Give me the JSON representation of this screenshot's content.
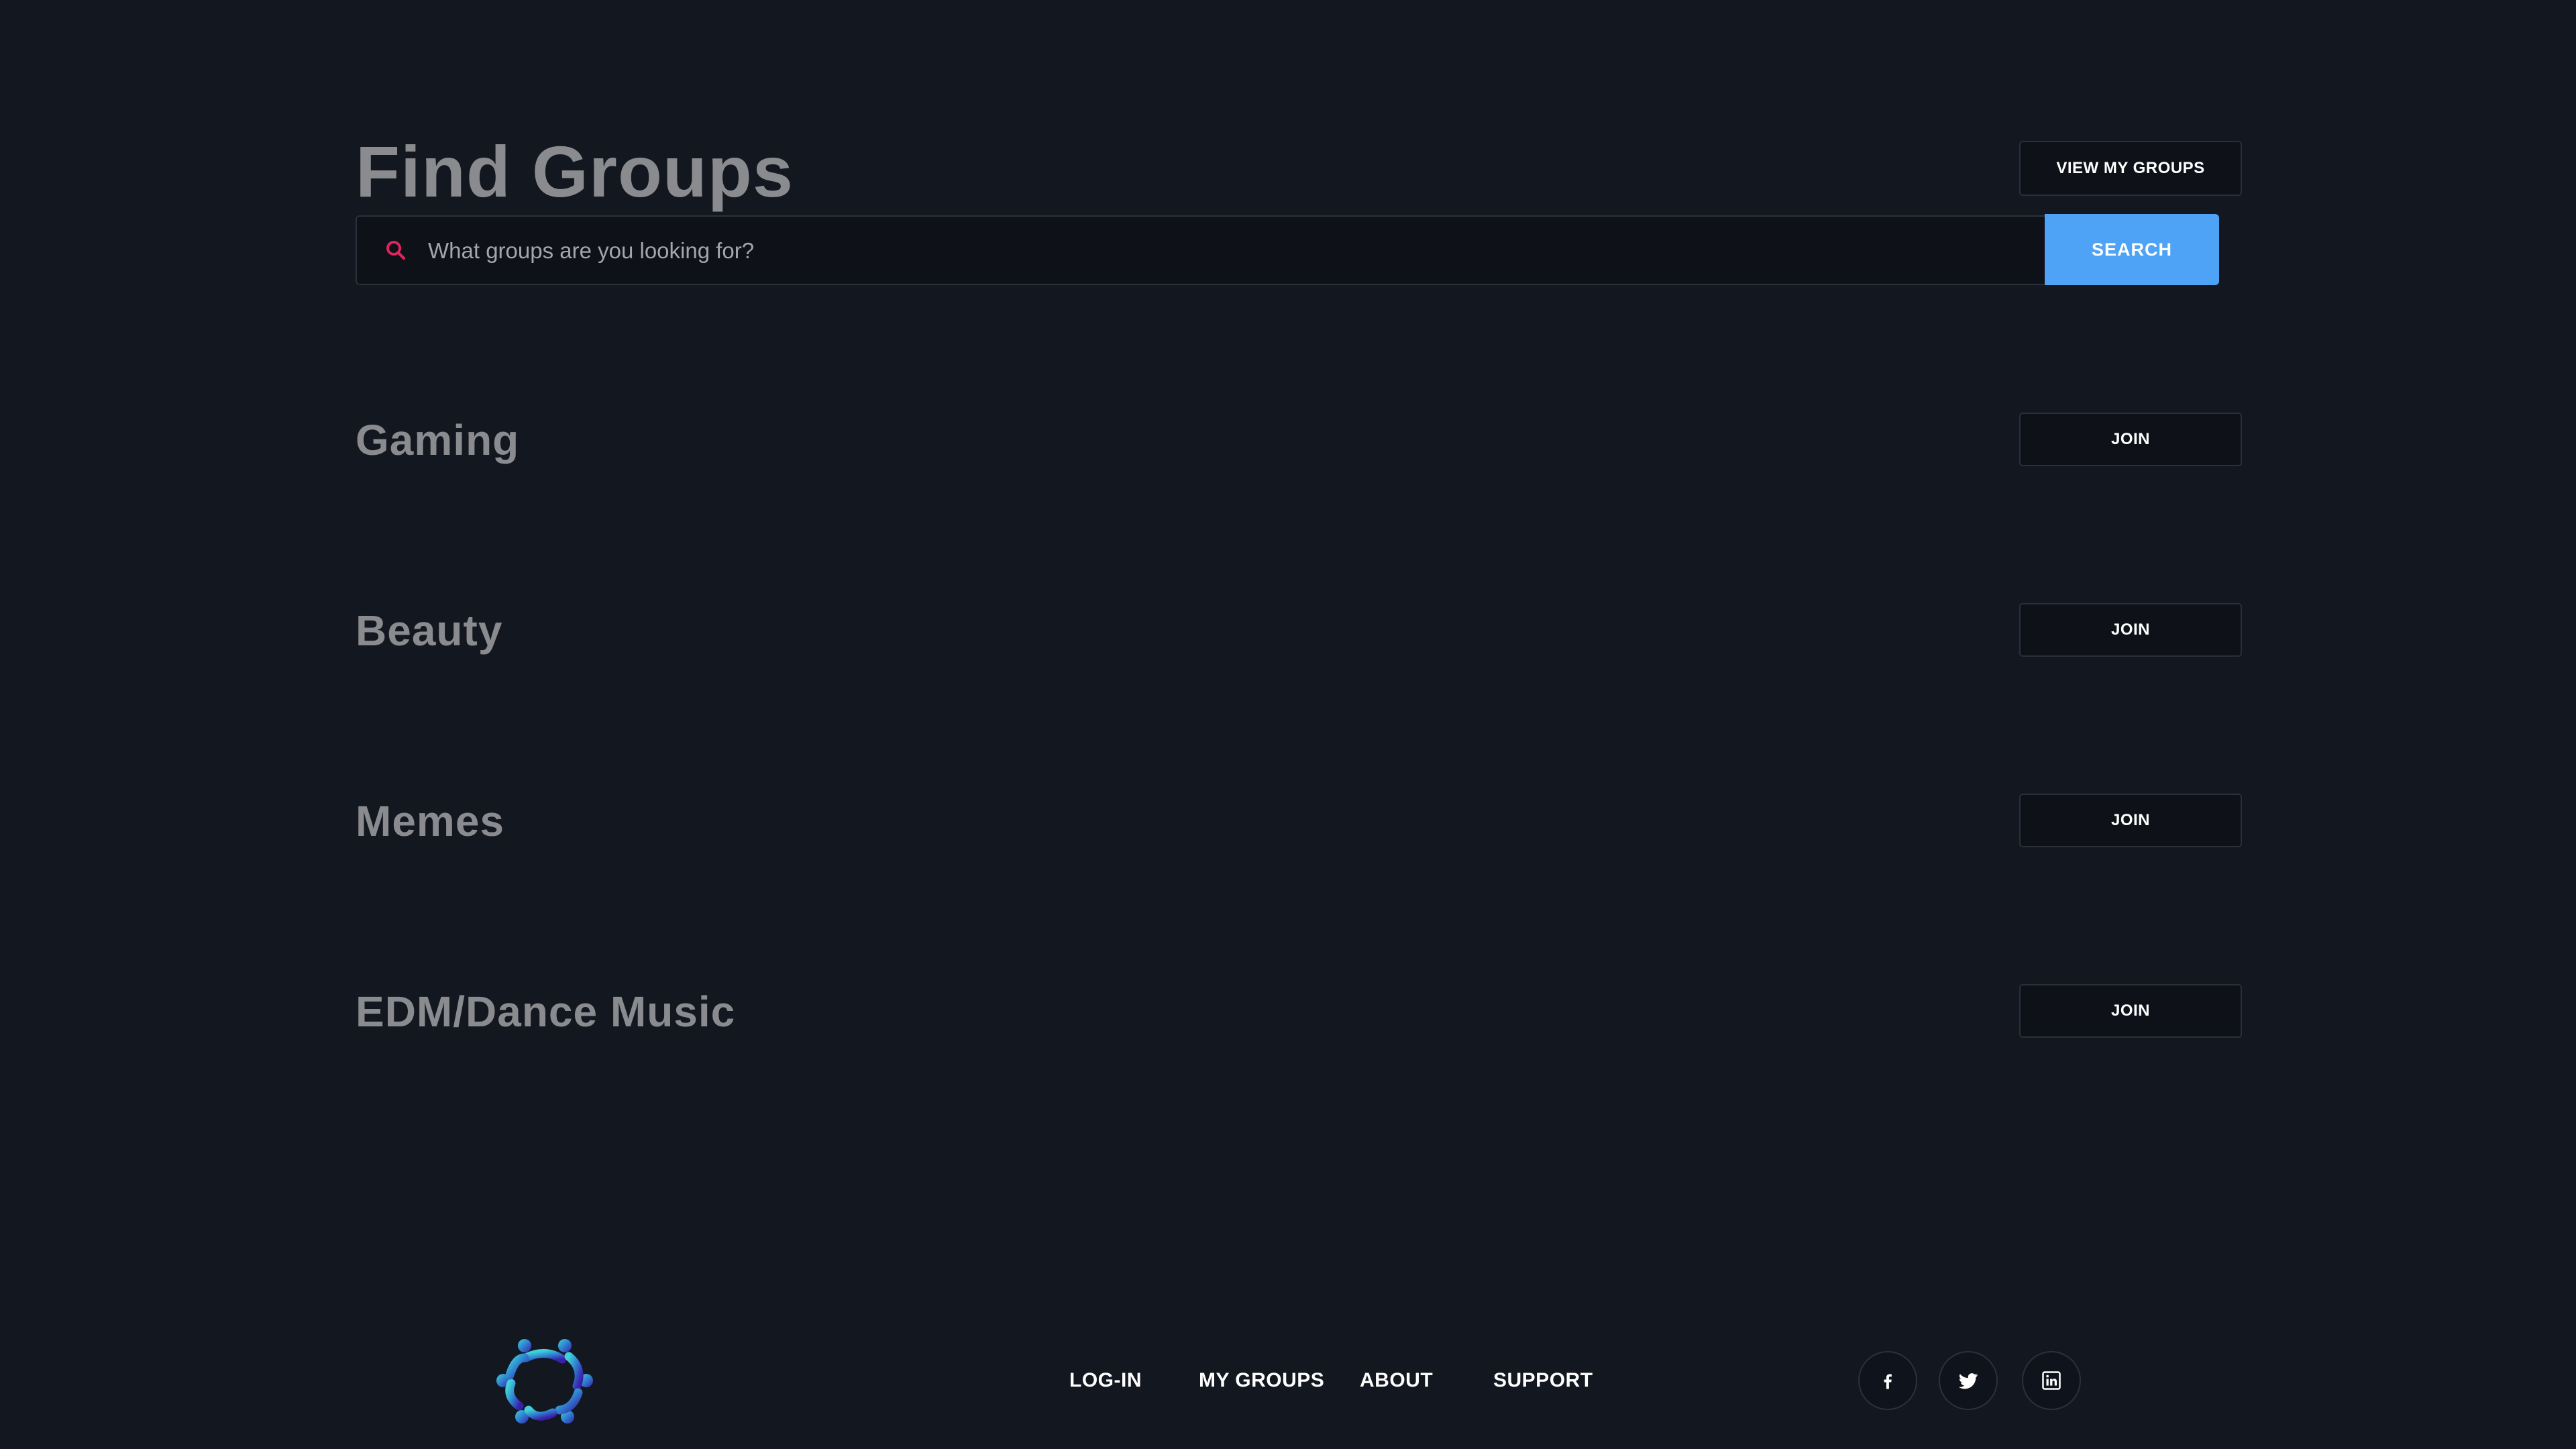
{
  "header": {
    "title": "Find Groups",
    "view_my_groups_label": "VIEW MY GROUPS"
  },
  "search": {
    "placeholder": "What groups are you looking for?",
    "button_label": "SEARCH",
    "icon": "search-icon",
    "icon_color": "#e0245e"
  },
  "groups": [
    {
      "name": "Gaming",
      "join_label": "JOIN"
    },
    {
      "name": "Beauty",
      "join_label": "JOIN"
    },
    {
      "name": "Memes",
      "join_label": "JOIN"
    },
    {
      "name": "EDM/Dance Music",
      "join_label": "JOIN"
    }
  ],
  "footer": {
    "logo": "community-logo",
    "links": [
      "LOG-IN",
      "MY GROUPS",
      "ABOUT",
      "SUPPORT"
    ],
    "social": [
      "facebook-icon",
      "twitter-icon",
      "linkedin-icon"
    ]
  },
  "colors": {
    "background": "#131720",
    "accent": "#4ea3f7",
    "heading": "#8a8b8e",
    "button_bg": "#0e1118"
  }
}
